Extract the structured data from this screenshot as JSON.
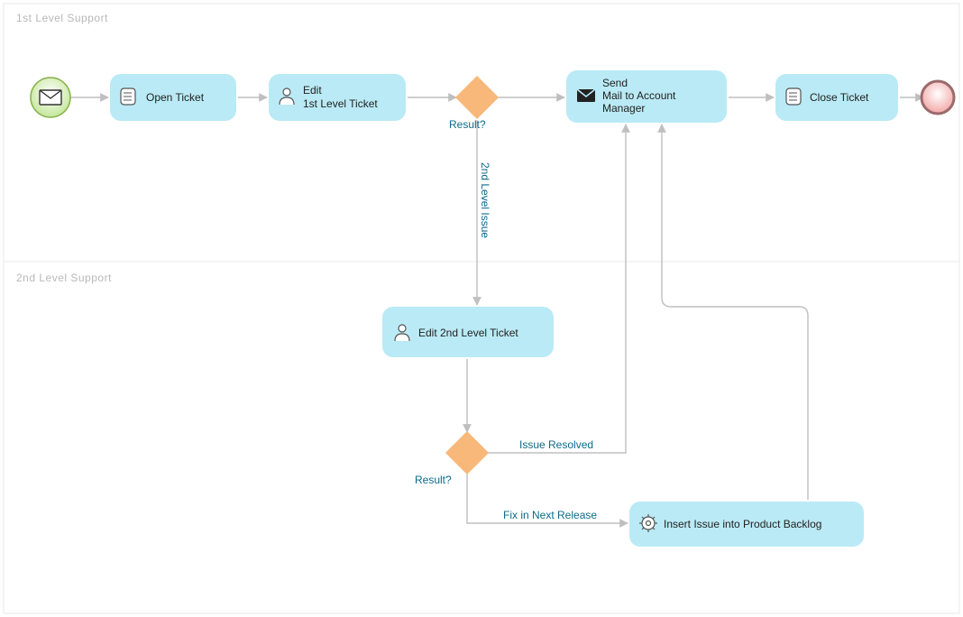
{
  "lanes": {
    "first": {
      "label": "1st Level Support"
    },
    "second": {
      "label": "2nd Level Support"
    }
  },
  "tasks": {
    "open_ticket": {
      "label": "Open Ticket"
    },
    "edit_1st": {
      "line1": "Edit",
      "line2": "1st Level Ticket"
    },
    "send_mail": {
      "line1": "Send",
      "line2": "Mail to Account",
      "line3": "Manager"
    },
    "close_ticket": {
      "label": "Close Ticket"
    },
    "edit_2nd": {
      "label": "Edit 2nd Level Ticket"
    },
    "insert_backlog": {
      "label": "Insert Issue into Product Backlog"
    }
  },
  "gateways": {
    "g1_label": "Result?",
    "g2_label": "Result?"
  },
  "flows": {
    "second_level_issue": "2nd Level Issue",
    "issue_resolved": "Issue Resolved",
    "fix_next_release": "Fix in Next Release"
  },
  "chart_data": {
    "type": "bpmn-diagram",
    "lanes": [
      {
        "id": "L1",
        "name": "1st Level Support"
      },
      {
        "id": "L2",
        "name": "2nd Level Support"
      }
    ],
    "elements": [
      {
        "id": "start",
        "type": "startEvent",
        "marker": "message",
        "lane": "L1"
      },
      {
        "id": "open_ticket",
        "type": "task",
        "subtype": "script",
        "label": "Open Ticket",
        "lane": "L1"
      },
      {
        "id": "edit_1st",
        "type": "task",
        "subtype": "user",
        "label": "Edit 1st Level Ticket",
        "lane": "L1"
      },
      {
        "id": "g1",
        "type": "exclusiveGateway",
        "label": "Result?",
        "lane": "L1"
      },
      {
        "id": "send_mail",
        "type": "task",
        "subtype": "send",
        "label": "Send Mail to Account Manager",
        "lane": "L1"
      },
      {
        "id": "close_ticket",
        "type": "task",
        "subtype": "script",
        "label": "Close Ticket",
        "lane": "L1"
      },
      {
        "id": "end",
        "type": "endEvent",
        "lane": "L1"
      },
      {
        "id": "edit_2nd",
        "type": "task",
        "subtype": "user",
        "label": "Edit 2nd Level Ticket",
        "lane": "L2"
      },
      {
        "id": "g2",
        "type": "exclusiveGateway",
        "label": "Result?",
        "lane": "L2"
      },
      {
        "id": "insert_backlog",
        "type": "task",
        "subtype": "service",
        "label": "Insert Issue into Product Backlog",
        "lane": "L2"
      }
    ],
    "flows": [
      {
        "from": "start",
        "to": "open_ticket"
      },
      {
        "from": "open_ticket",
        "to": "edit_1st"
      },
      {
        "from": "edit_1st",
        "to": "g1"
      },
      {
        "from": "g1",
        "to": "send_mail"
      },
      {
        "from": "g1",
        "to": "edit_2nd",
        "label": "2nd Level Issue"
      },
      {
        "from": "send_mail",
        "to": "close_ticket"
      },
      {
        "from": "close_ticket",
        "to": "end"
      },
      {
        "from": "edit_2nd",
        "to": "g2"
      },
      {
        "from": "g2",
        "to": "send_mail",
        "label": "Issue Resolved"
      },
      {
        "from": "g2",
        "to": "insert_backlog",
        "label": "Fix in Next Release"
      },
      {
        "from": "insert_backlog",
        "to": "send_mail"
      }
    ]
  }
}
